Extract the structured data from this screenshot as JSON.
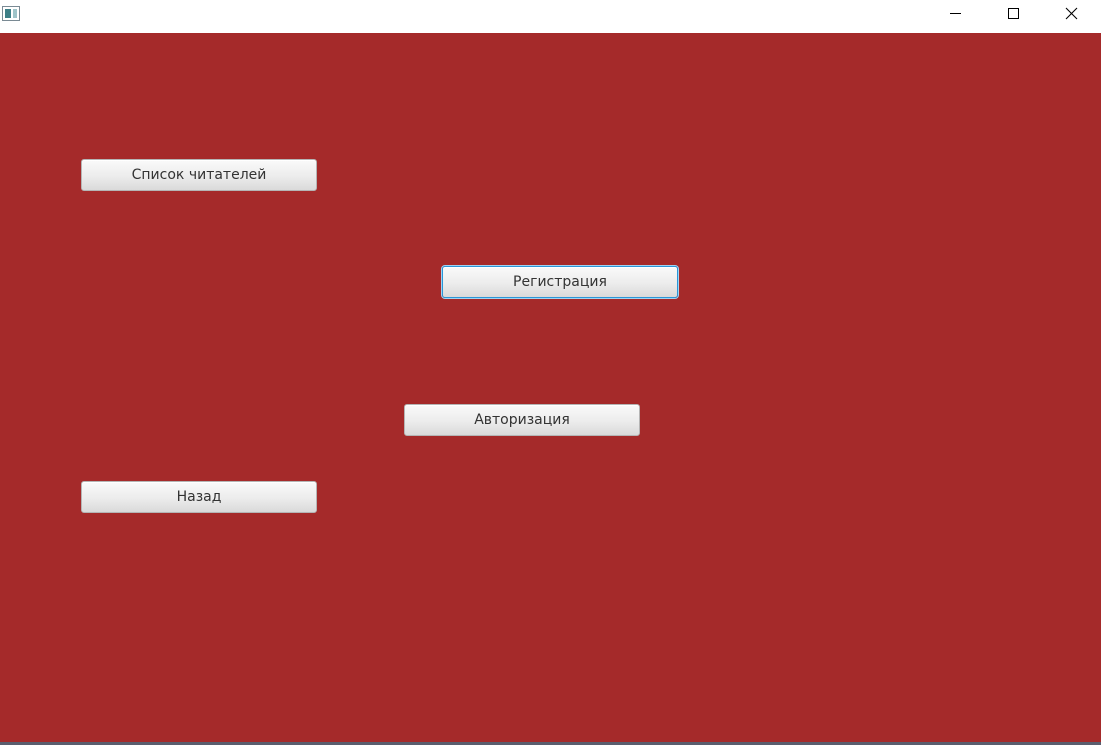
{
  "window": {
    "title": "",
    "controls": {
      "minimize": "minimize-icon",
      "maximize": "maximize-icon",
      "close": "close-icon"
    }
  },
  "colors": {
    "background": "#a52a2a",
    "titlebar": "#ffffff",
    "focus_ring": "#2a96d8"
  },
  "buttons": {
    "readers_list": "Список читателей",
    "registration": "Регистрация",
    "authorization": "Авторизация",
    "back": "Назад"
  },
  "focused_button": "registration"
}
